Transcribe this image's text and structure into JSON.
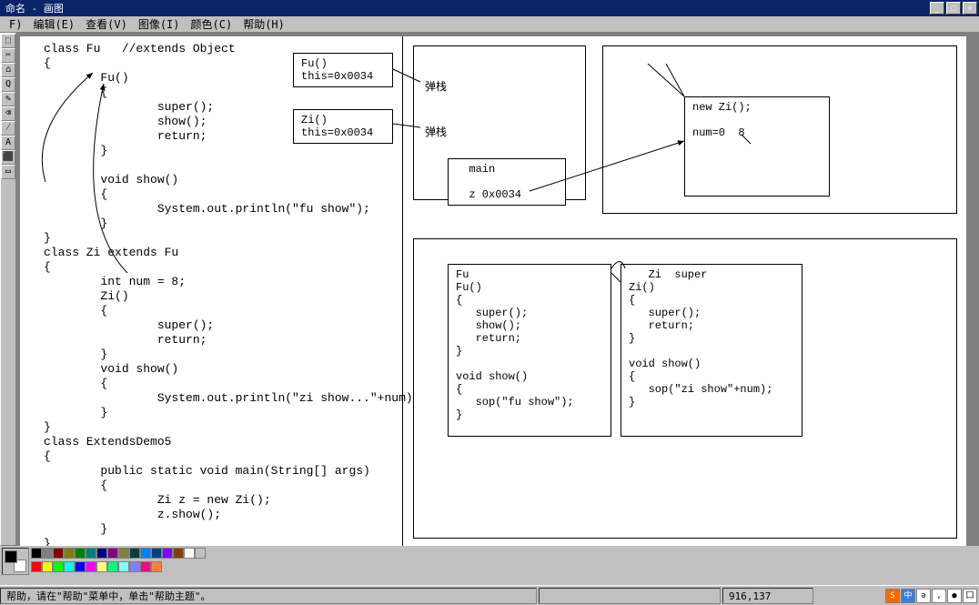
{
  "window": {
    "title": "命名 - 画图",
    "min": "_",
    "max": "□",
    "close": "×"
  },
  "menu": {
    "file": "F)",
    "edit": "编辑(E)",
    "view": "查看(V)",
    "image": "图像(I)",
    "colors": "颜色(C)",
    "help": "帮助(H)"
  },
  "tools": [
    "⬚",
    "✂",
    "⌂",
    "Q",
    "✎",
    "⌫",
    "⁄",
    "A",
    "⬛",
    "▭"
  ],
  "code": {
    "left_block": "class Fu   //extends Object\n{\n        Fu()\n        {\n                super();\n                show();\n                return;\n        }\n\n        void show()\n        {\n                System.out.println(\"fu show\");\n        }\n}\nclass Zi extends Fu\n{\n        int num = 8;\n        Zi()\n        {\n                super();\n                return;\n        }\n        void show()\n        {\n                System.out.println(\"zi show...\"+num);\n        }\n}\nclass ExtendsDemo5\n{\n        public static void main(String[] args)\n        {\n                Zi z = new Zi();\n                z.show();\n        }\n}"
  },
  "boxes": {
    "stack1": "Fu()\nthis=0x0034",
    "stack2": "Zi()\nthis=0x0034",
    "pop1": "弹栈",
    "pop2": "弹栈",
    "main": "  main\n\n  z 0x0034",
    "heap": "new Zi();\n\nnum=0  8",
    "fu_block": "Fu\nFu()\n{\n   super();\n   show();\n   return;\n}\n\nvoid show()\n{\n   sop(\"fu show\");\n}",
    "zi_block": "   Zi  super\nZi()\n{\n   super();\n   return;\n}\n\nvoid show()\n{\n   sop(\"zi show\"+num);\n}"
  },
  "palette": [
    "#000000",
    "#808080",
    "#800000",
    "#808000",
    "#008000",
    "#008080",
    "#000080",
    "#800080",
    "#808040",
    "#004040",
    "#0080ff",
    "#004080",
    "#8000ff",
    "#804000",
    "#ffffff",
    "#c0c0c0",
    "#ff0000",
    "#ffff00",
    "#00ff00",
    "#00ffff",
    "#0000ff",
    "#ff00ff",
    "#ffff80",
    "#00ff80",
    "#80ffff",
    "#8080ff",
    "#ff0080",
    "#ff8040"
  ],
  "status": {
    "help": "帮助，请在\"帮助\"菜单中，单击\"帮助主题\"。",
    "coords": "916,137"
  },
  "tray": [
    "S",
    "中",
    "ə",
    ",",
    "●",
    "囗"
  ]
}
